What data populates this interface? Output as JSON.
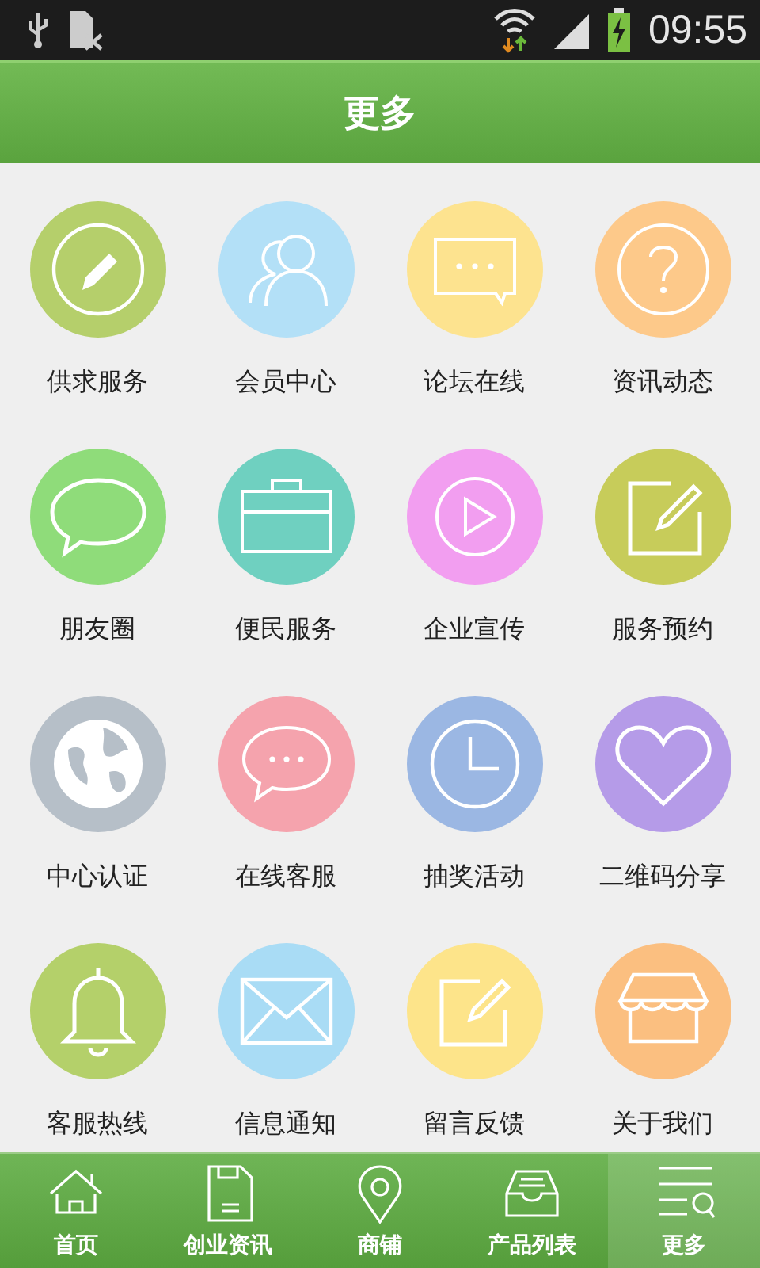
{
  "status_bar": {
    "time": "09:55"
  },
  "header": {
    "title": "更多"
  },
  "items": [
    {
      "label": "供求服务",
      "color": "#b5cf6b"
    },
    {
      "label": "会员中心",
      "color": "#b3e0f7"
    },
    {
      "label": "论坛在线",
      "color": "#fde38f"
    },
    {
      "label": "资讯动态",
      "color": "#fdc98a"
    },
    {
      "label": "朋友圈",
      "color": "#8fdc7a"
    },
    {
      "label": "便民服务",
      "color": "#6fd0c0"
    },
    {
      "label": "企业宣传",
      "color": "#f29ef0"
    },
    {
      "label": "服务预约",
      "color": "#c7cc5a"
    },
    {
      "label": "中心认证",
      "color": "#b6bfc8"
    },
    {
      "label": "在线客服",
      "color": "#f5a3ad"
    },
    {
      "label": "抽奖活动",
      "color": "#9bb7e3"
    },
    {
      "label": "二维码分享",
      "color": "#b59be8"
    },
    {
      "label": "客服热线",
      "color": "#b4d06a"
    },
    {
      "label": "信息通知",
      "color": "#a9dcf5"
    },
    {
      "label": "留言反馈",
      "color": "#fde48a"
    },
    {
      "label": "关于我们",
      "color": "#fbbf80"
    }
  ],
  "tab_bar": [
    {
      "label": "首页",
      "selected": false
    },
    {
      "label": "创业资讯",
      "selected": false
    },
    {
      "label": "商铺",
      "selected": false
    },
    {
      "label": "产品列表",
      "selected": false
    },
    {
      "label": "更多",
      "selected": true
    }
  ]
}
